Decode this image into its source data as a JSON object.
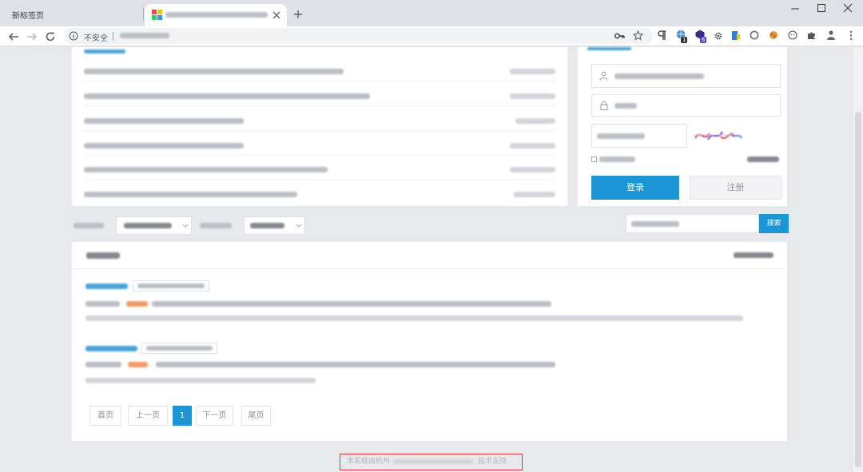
{
  "tabs": [
    {
      "label": "新标签页"
    },
    {
      "favicon": "colorful-favicon-icon",
      "close_icon": "close-icon"
    }
  ],
  "address_bar": {
    "security_label": "不安全",
    "info_icon": "info-icon",
    "right_icons": [
      "key-icon",
      "star-icon"
    ]
  },
  "extensions": {
    "icons": [
      "paragraph-icon",
      "globe-extension-icon",
      "cube-extension-icon",
      "gear-icon",
      "bookmark-extension-icon",
      "circle-extension-icon",
      "cookie-extension-icon",
      "smiley-extension-icon",
      "puzzle-icon",
      "profile-icon",
      "menu-dots-icon"
    ],
    "globe_badge": "1",
    "cube_badge": "6"
  },
  "window_controls": [
    "minimize-icon",
    "maximize-icon",
    "close-icon"
  ],
  "login": {
    "login_button": "登录",
    "register_button": "注册",
    "field_icons": [
      "user-icon",
      "lock-icon"
    ]
  },
  "search": {
    "button": "搜索"
  },
  "pagination": {
    "first": "首页",
    "prev": "上一页",
    "current": "1",
    "next": "下一页",
    "last": "尾页"
  },
  "footer": {
    "prefix": "本系统由杭州",
    "suffix": "技术支持"
  },
  "colors": {
    "accent": "#1b95d4",
    "highlight": "#f39a68",
    "footer_border": "#e0303a",
    "page_background": "#e8e9ed"
  }
}
